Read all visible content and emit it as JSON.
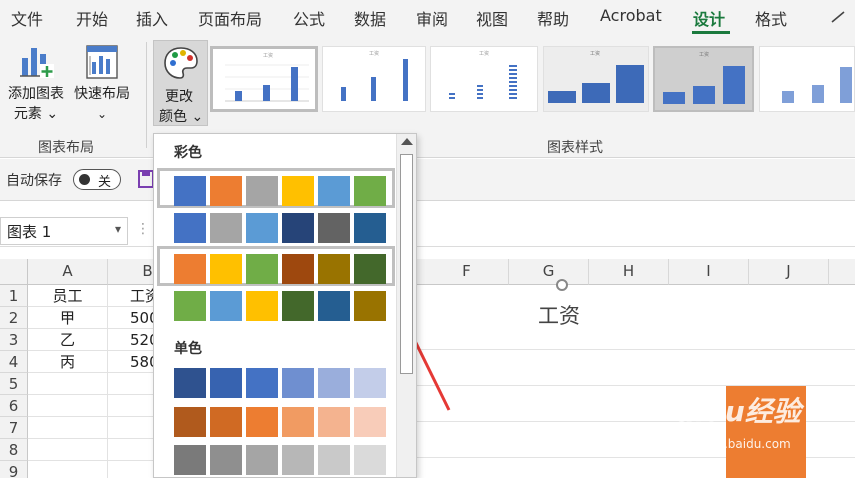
{
  "menu": {
    "items": [
      "文件",
      "开始",
      "插入",
      "页面布局",
      "公式",
      "数据",
      "审阅",
      "视图",
      "帮助",
      "Acrobat",
      "设计",
      "格式"
    ],
    "active": "设计",
    "accent": "#1b7a3e"
  },
  "ribbon": {
    "add_chart_element": [
      "添加图表",
      "元素 ⌄"
    ],
    "quick_layout": "快速布局",
    "change_color": [
      "更改",
      "颜色 ⌄"
    ],
    "group_chart_layout": "图表布局",
    "group_chart_styles": "图表样式",
    "thumb_title_small": "工资"
  },
  "autosave": {
    "label": "自动保存",
    "toggle_text": "关"
  },
  "namebox": {
    "value": "图表 1"
  },
  "sheet": {
    "columns": [
      "A",
      "B",
      "F",
      "G",
      "H",
      "I",
      "J"
    ],
    "rows": [
      "1",
      "2",
      "3",
      "4",
      "5",
      "6",
      "7",
      "8",
      "9"
    ],
    "colA": [
      "员工",
      "甲",
      "乙",
      "丙"
    ],
    "colB": [
      "工资",
      "500",
      "520",
      "580"
    ]
  },
  "chart": {
    "title": "工资",
    "bar_color": "#ed7d31"
  },
  "palette": {
    "colorful_label": "彩色",
    "mono_label": "单色",
    "colorful_rows": [
      [
        "#4472c4",
        "#ed7d31",
        "#a5a5a5",
        "#ffc000",
        "#5b9bd5",
        "#70ad47"
      ],
      [
        "#4472c4",
        "#a5a5a5",
        "#5b9bd5",
        "#264478",
        "#636363",
        "#255e91"
      ],
      [
        "#ed7d31",
        "#ffc000",
        "#70ad47",
        "#9e480e",
        "#997300",
        "#43682b"
      ],
      [
        "#70ad47",
        "#5b9bd5",
        "#ffc000",
        "#43682b",
        "#255e91",
        "#997300"
      ]
    ],
    "mono_rows": [
      [
        "#2f528f",
        "#3763b0",
        "#4472c4",
        "#6f8fd0",
        "#9aaedc",
        "#c3cde9"
      ],
      [
        "#b05a1d",
        "#d06a23",
        "#ed7d31",
        "#f19b62",
        "#f4b38f",
        "#f8ccb9"
      ],
      [
        "#7a7a7a",
        "#8f8f8f",
        "#a5a5a5",
        "#b7b7b7",
        "#c9c9c9",
        "#dadada"
      ]
    ]
  },
  "watermark": {
    "main": "Baidu经验",
    "sub": "jingyan.baidu.com"
  }
}
